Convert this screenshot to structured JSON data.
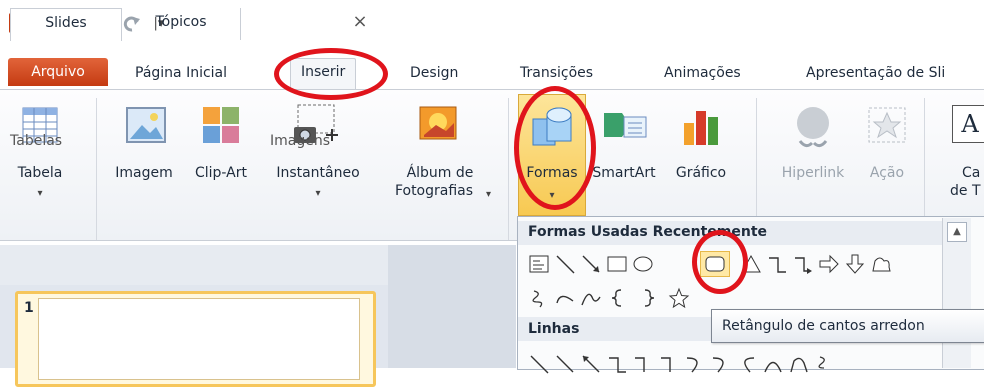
{
  "qat": {
    "icons": [
      "powerpoint-logo",
      "save-icon",
      "undo-icon",
      "redo-icon",
      "customize-icon"
    ],
    "dropdown_glyph": "▾",
    "customize_glyph": "|▾"
  },
  "tabs": {
    "file": "Arquivo",
    "home": "Página Inicial",
    "insert": "Inserir",
    "design": "Design",
    "transitions": "Transições",
    "animations": "Animações",
    "slideshow": "Apresentação de Sli"
  },
  "ribbon": {
    "table": "Tabela",
    "image": "Imagem",
    "clipart": "Clip-Art",
    "screenshot": "Instantâneo",
    "album_line1": "Álbum de",
    "album_line2": "Fotografias",
    "shapes": "Formas",
    "smartart": "SmartArt",
    "chart": "Gráfico",
    "hyperlink": "Hiperlink",
    "action": "Ação",
    "textbox_line1": "Ca",
    "textbox_line2": "de T",
    "textbox_icon_letter": "A",
    "arrow": "▾",
    "groups": {
      "tables": "Tabelas",
      "images": "Imagens"
    }
  },
  "pane": {
    "tab_slides": "Slides",
    "tab_outline": "Tópicos",
    "close": "×",
    "slide_number": "1"
  },
  "gallery": {
    "recent_header": "Formas Usadas Recentemente",
    "lines_header": "Linhas",
    "scroll_up": "▲"
  },
  "tooltip": {
    "text": "Retângulo de cantos arredon"
  },
  "colors": {
    "file_tab": "#d24c1e",
    "annotation": "#e0141c",
    "selection": "#f6c65b"
  }
}
